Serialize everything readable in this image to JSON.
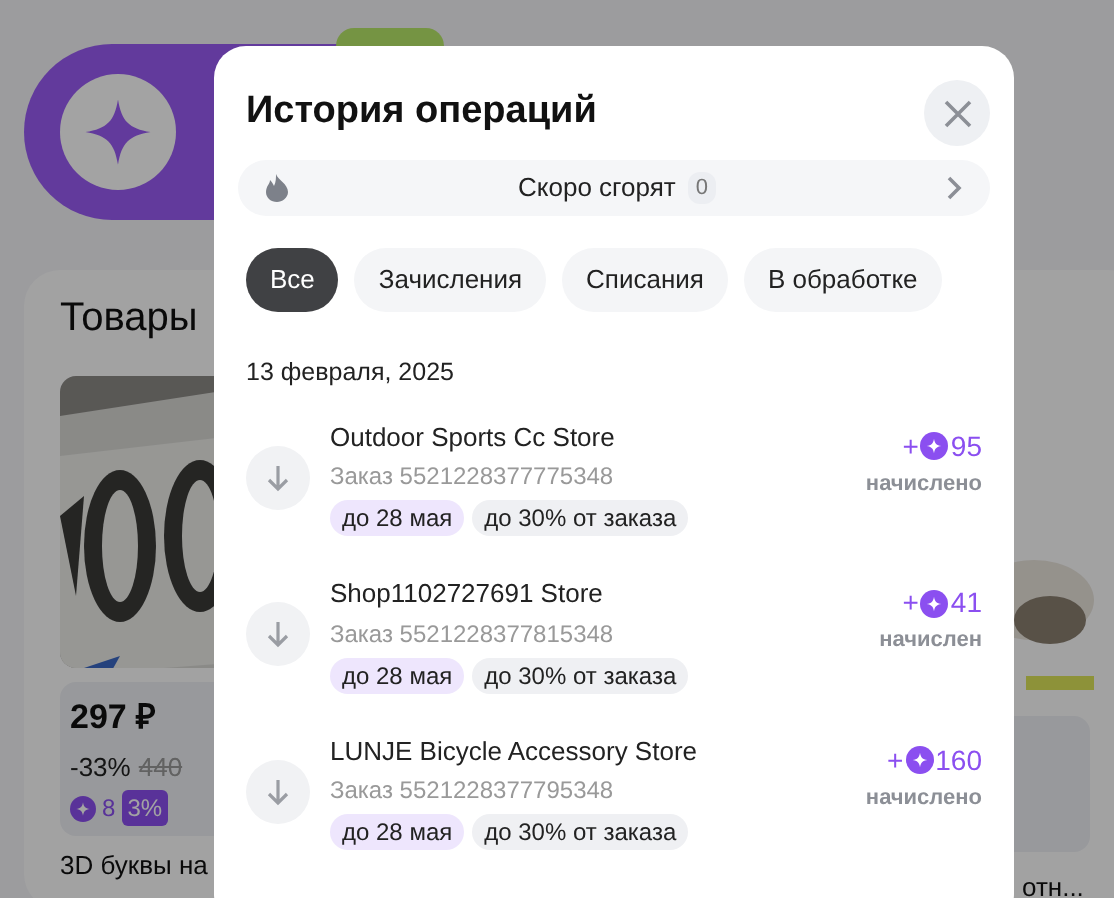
{
  "background": {
    "section_title": "Товары",
    "product": {
      "price": "297 ₽",
      "discount": "-33%",
      "old_price": "440",
      "bonus": "8",
      "bonus_percent": "3%",
      "title": "3D буквы на"
    },
    "product_2": {
      "title": "отн..."
    }
  },
  "modal": {
    "title": "История операций",
    "burn": {
      "label": "Скоро сгорят",
      "count": "0"
    },
    "tabs": [
      {
        "label": "Все",
        "selected": true
      },
      {
        "label": "Зачисления",
        "selected": false
      },
      {
        "label": "Списания",
        "selected": false
      },
      {
        "label": "В обработке",
        "selected": false
      }
    ],
    "date": "13 февраля, 2025",
    "operations": [
      {
        "store": "Outdoor Sports Cc Store",
        "order": "Заказ 5521228377775348",
        "expires": "до 28 мая",
        "limit": "до 30% от заказа",
        "sign": "+",
        "amount": "95",
        "status": "начислено"
      },
      {
        "store": "Shop1102727691 Store",
        "order": "Заказ 5521228377815348",
        "expires": "до 28 мая",
        "limit": "до 30% от заказа",
        "sign": "+",
        "amount": "41",
        "status": "начислен"
      },
      {
        "store": "LUNJE Bicycle Accessory Store",
        "order": "Заказ 5521228377795348",
        "expires": "до 28 мая",
        "limit": "до 30% от заказа",
        "sign": "+",
        "amount": "160",
        "status": "начислено"
      }
    ]
  }
}
